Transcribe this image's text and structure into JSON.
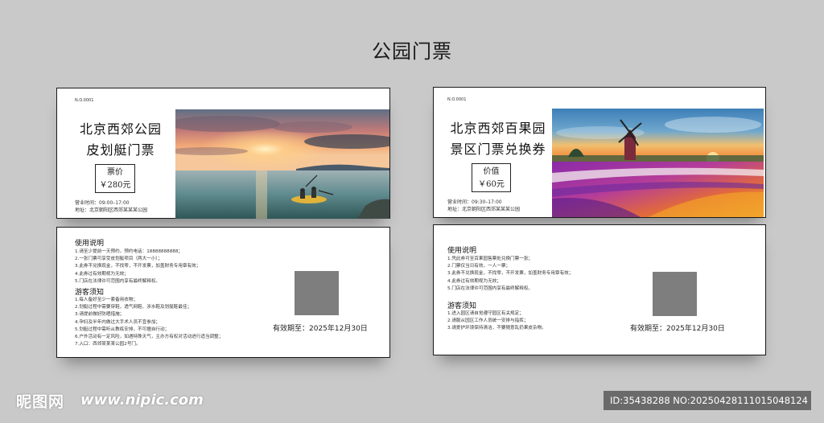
{
  "page": {
    "title": "公园门票"
  },
  "tickets": [
    {
      "serial": "N.O.0001",
      "title_line1": "北京西郊公园",
      "title_line2": "皮划艇门票",
      "price_label": "票价",
      "price_value": "￥280元",
      "hours": "营业时间：09:00–17:00",
      "address": "地址：北京朝阳区西郊某某某公园",
      "photo": "kayak-sunset-photo",
      "back": {
        "usage_title": "使用说明",
        "usage_items": [
          "1.请至少提前一天预约，预约电话：18888888888；",
          "2.一张门票可享受皮划艇项目（两大一小）；",
          "3.此券不兑换现金，不找零，不开发票，加盖财务专用章有效；",
          "4.此券过有效期视为无效；",
          "5.门店在法律许可范围内享有最终解释权。"
        ],
        "notice_title": "游客须知",
        "notice_items": [
          "1.每人备好至少一套备用衣物；",
          "2.划艇过程中需要穿鞋，透气网鞋、涉水鞋及划艇鞋最佳；",
          "3.请提前做好防晒措施；",
          "4.孕妇及半年内做过大手术人员不宜参加；",
          "5.划艇过程中需听从教练安排，不可擅自行动；",
          "6.户外活动有一定风险，如遇特殊天气，主办方有权对活动进行适当调整；",
          "7.入口：西郊某某某公园2号门。"
        ],
        "validity": "有效期至：2025年12月30日"
      }
    },
    {
      "serial": "N.O.0001",
      "title_line1": "北京西郊百果园",
      "title_line2": "景区门票兑换券",
      "price_label": "价值",
      "price_value": "￥60元",
      "hours": "营业时间：09:30–17:00",
      "address": "地址：北京朝阳区西郊某某某公园",
      "photo": "windmill-tulip-photo",
      "back": {
        "usage_title": "使用说明",
        "usage_items": [
          "1.凭此券可至百果园售票处兑换门票一张；",
          "2.门票仅当日有效，一人一票；",
          "3.此券不兑换现金，不找零，不开发票，加盖财务专用章有效；",
          "4.此券过有效期视为无效；",
          "5.门店在法律许可范围内享有最终解释权。"
        ],
        "notice_title": "游客须知",
        "notice_items": [
          "1.进入园区请自觉遵守园区有关规定；",
          "2.请服从园区工作人员统一安排与指挥；",
          "3.请爱护环境保持清洁，不要随意乱扔果皮杂物。"
        ],
        "validity": "有效期至：2025年12月30日"
      }
    }
  ],
  "watermark": {
    "logo_text": "昵图网",
    "url": "www.nipic.com",
    "id_text": "ID:35438288 NO:20250428111015048124"
  }
}
